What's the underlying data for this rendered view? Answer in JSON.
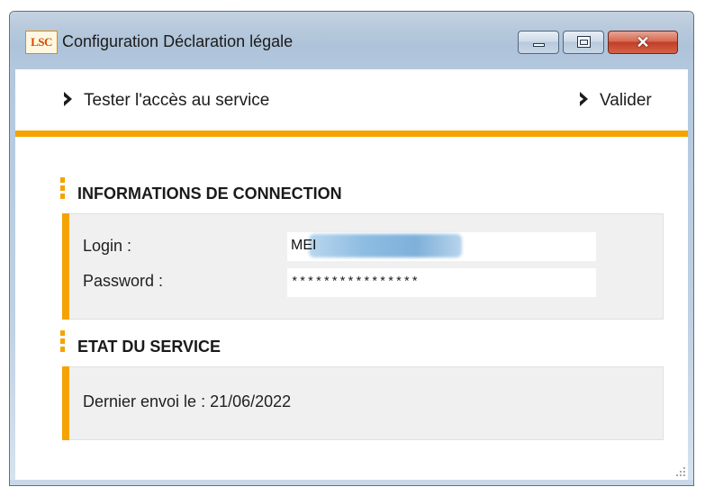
{
  "window": {
    "app_logo_text": "LSC",
    "title": "Configuration Déclaration légale",
    "close_glyph": "✕",
    "controls": [
      "minimize-icon",
      "maximize-icon",
      "close-icon"
    ]
  },
  "toolbar": {
    "test_label": "Tester l'accès au service",
    "validate_label": "Valider",
    "chevron_icon": "chevron-right-icon"
  },
  "connection": {
    "section_title": "INFORMATIONS DE CONNECTION",
    "login_label": "Login :",
    "login_value": "MEI",
    "password_label": "Password :",
    "password_value": "****************"
  },
  "service": {
    "section_title": "ETAT DU SERVICE",
    "last_sent_text": "Dernier envoi le : 21/06/2022"
  },
  "colors": {
    "accent": "#f5a300",
    "panel_bg": "#f0f0f0",
    "titlebar": "#b7c9dc"
  }
}
